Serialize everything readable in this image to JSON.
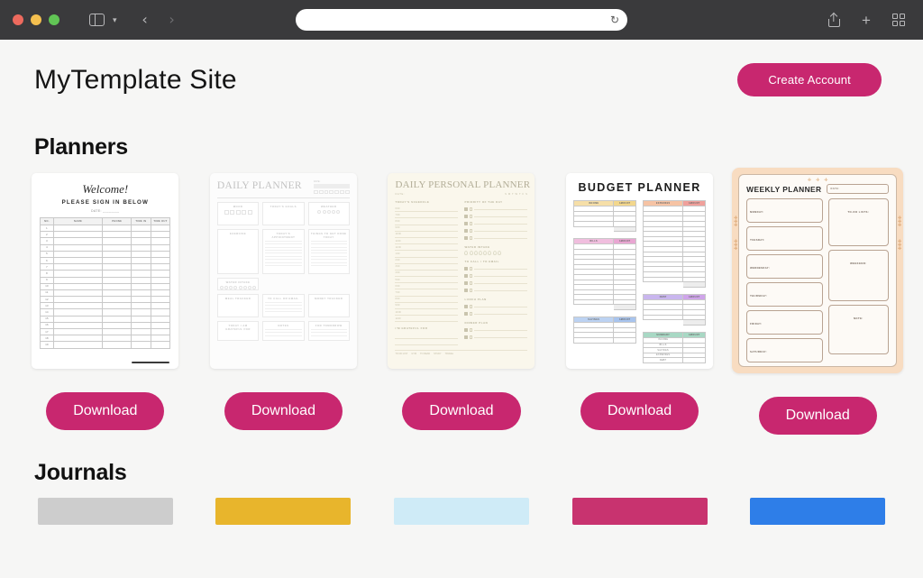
{
  "browser": {
    "window_controls": [
      "close",
      "minimize",
      "maximize"
    ],
    "sidebar_toggle_label": "Sidebar",
    "back_label": "‹",
    "forward_label": "›",
    "url_value": "",
    "url_placeholder": "",
    "reload_label": "↻",
    "share_label": "Share",
    "new_tab_label": "+",
    "tab_overview_label": "Tab Overview"
  },
  "site": {
    "title": "MyTemplate Site",
    "create_account_label": "Create Account",
    "accent_color": "#c8276f",
    "background_color": "#f6f6f5"
  },
  "sections": {
    "planners": {
      "heading": "Planners"
    },
    "journals": {
      "heading": "Journals"
    }
  },
  "planners": [
    {
      "name": "sign-in-sheet",
      "download_label": "Download"
    },
    {
      "name": "daily-planner",
      "download_label": "Download"
    },
    {
      "name": "daily-personal-planner",
      "download_label": "Download"
    },
    {
      "name": "budget-planner",
      "download_label": "Download"
    },
    {
      "name": "weekly-planner",
      "download_label": "Download"
    }
  ],
  "thumb_signin": {
    "welcome": "Welcome!",
    "subtitle": "PLEASE SIGN IN BELOW",
    "date_label": "DATE:",
    "columns": [
      "NO.",
      "NAME",
      "PHONE",
      "TIME IN",
      "TIME OUT"
    ],
    "rows": [
      "1",
      "2",
      "3",
      "4",
      "5",
      "6",
      "7",
      "8",
      "9",
      "10",
      "11",
      "12",
      "13",
      "14",
      "15",
      "16",
      "17",
      "18",
      "19"
    ]
  },
  "thumb_daily": {
    "title": "DAILY PLANNER",
    "date_label": "DATE:",
    "sections": [
      "MOOD",
      "TODAY'S GOALS",
      "WEATHER",
      "EXERCISE",
      "TODAY'S APPOINTMENT",
      "ANIMALS LED TO",
      "WATER INTAKE",
      "THINGS TO GET DONE TODAY",
      "MEAL TRACKER",
      "TO CALL OR EMAIL",
      "MONEY TRACKER",
      "TODAY I AM GRATEFUL FOR",
      "NOTES",
      "FOR TOMORROW"
    ]
  },
  "thumb_personal": {
    "title": "DAILY PERSONAL PLANNER",
    "date_label": "DATE:",
    "weekdays": "S  M  T  W  T  F  S",
    "left_heading": "TODAY'S SCHEDULE",
    "right_headings": [
      "PRIORITY OF THE DAY",
      "WATER INTAKE",
      "TO CALL / TO EMAIL",
      "LUNCH PLAN",
      "DINNER PLAN"
    ],
    "gratitude": "I'M GRATEFUL FOR",
    "times": [
      "6:00",
      "7:00",
      "8:00",
      "9:00",
      "10:00",
      "11:00",
      "12:00",
      "1:00",
      "2:00",
      "3:00",
      "4:00",
      "5:00",
      "6:00",
      "7:00",
      "8:00",
      "9:00",
      "10:00",
      "11:00"
    ],
    "footer": [
      "TO DO LIST",
      "GYM",
      "TO READ",
      "STUDY",
      "TRAVEL"
    ]
  },
  "thumb_budget": {
    "title": "BUDGET PLANNER",
    "tables": [
      {
        "name": "income",
        "header": [
          "INCOME",
          "AMOUNT"
        ],
        "header_color": "#f6dfa8",
        "amount_color": "#f3d78c",
        "rows": 4,
        "total": true
      },
      {
        "name": "bills",
        "header": [
          "BILLS",
          "AMOUNT"
        ],
        "header_color": "#f0bede",
        "amount_color": "#e9a6d2",
        "rows": 12,
        "total": true
      },
      {
        "name": "savings",
        "header": [
          "SAVINGS",
          "AMOUNT"
        ],
        "header_color": "#bcd2f2",
        "amount_color": "#a8c4ee",
        "rows": 4,
        "total": false
      },
      {
        "name": "expenses",
        "header": [
          "EXPENSES",
          "AMOUNT"
        ],
        "header_color": "#f6c3a4",
        "amount_color": "#f0a09b",
        "rows": 15,
        "total": true
      },
      {
        "name": "debt",
        "header": [
          "DEBT",
          "AMOUNT"
        ],
        "header_color": "#c9b6ee",
        "amount_color": "#cfa4ea",
        "rows": 4,
        "total": true
      },
      {
        "name": "summary",
        "header": [
          "SUMMARY",
          "AMOUNT"
        ],
        "header_color": "#a8d8c4",
        "amount_color": "#a8d8c4",
        "rows": 0,
        "total": false,
        "summary_rows": [
          "INCOME",
          "BILLS",
          "SAVINGS",
          "EXPENSES",
          "DEBT"
        ]
      }
    ]
  },
  "thumb_weekly": {
    "title": "WEEKLY PLANNER",
    "date_label": "DATE:",
    "days": [
      "MONDAY:",
      "TUESDAY:",
      "WEDNESDAY:",
      "THURSDAY:",
      "FRIDAY:",
      "SATURDAY:"
    ],
    "right_boxes": [
      "TO-DO LISTS:",
      "WEEKEND:",
      "NOTE:"
    ],
    "frame_color": "#f8dcc1",
    "accent_color": "#d59a5c"
  },
  "journals": [
    {
      "name": "journal-gray",
      "color": "#cdcdcd"
    },
    {
      "name": "journal-gold",
      "color": "#e8b52c"
    },
    {
      "name": "journal-lightblue",
      "color": "#cfebf7"
    },
    {
      "name": "journal-magenta",
      "color": "#c8336f"
    },
    {
      "name": "journal-blue",
      "color": "#2e7ee8"
    }
  ]
}
